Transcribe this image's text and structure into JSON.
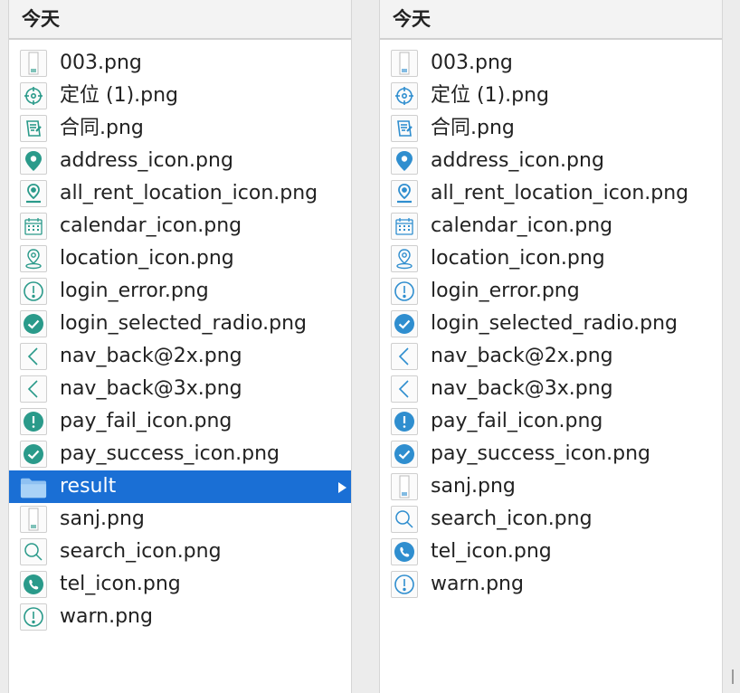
{
  "theme": {
    "left_accent": "#2a9a8a",
    "right_accent": "#2f8ecf",
    "selection": "#1a6fd5"
  },
  "columns": [
    {
      "header": "今天",
      "items": [
        {
          "label": "003.png",
          "icon": "tall-image-icon"
        },
        {
          "label": "定位 (1).png",
          "icon": "crosshair-icon"
        },
        {
          "label": "合同.png",
          "icon": "contract-icon"
        },
        {
          "label": "address_icon.png",
          "icon": "map-pin-filled-icon"
        },
        {
          "label": "all_rent_location_icon.png",
          "icon": "person-pin-icon"
        },
        {
          "label": "calendar_icon.png",
          "icon": "calendar-icon"
        },
        {
          "label": "location_icon.png",
          "icon": "map-pin-outline-icon"
        },
        {
          "label": "login_error.png",
          "icon": "alert-circle-icon"
        },
        {
          "label": "login_selected_radio.png",
          "icon": "check-circle-icon"
        },
        {
          "label": "nav_back@2x.png",
          "icon": "chevron-left-icon"
        },
        {
          "label": "nav_back@3x.png",
          "icon": "chevron-left-icon"
        },
        {
          "label": "pay_fail_icon.png",
          "icon": "alert-filled-icon"
        },
        {
          "label": "pay_success_icon.png",
          "icon": "check-circle-icon"
        },
        {
          "label": "result",
          "icon": "folder-icon",
          "selected": true
        },
        {
          "label": "sanj.png",
          "icon": "tall-image-icon"
        },
        {
          "label": "search_icon.png",
          "icon": "magnifier-icon"
        },
        {
          "label": "tel_icon.png",
          "icon": "phone-icon"
        },
        {
          "label": "warn.png",
          "icon": "alert-circle-icon"
        }
      ]
    },
    {
      "header": "今天",
      "items": [
        {
          "label": "003.png",
          "icon": "tall-image-icon"
        },
        {
          "label": "定位 (1).png",
          "icon": "crosshair-icon"
        },
        {
          "label": "合同.png",
          "icon": "contract-icon"
        },
        {
          "label": "address_icon.png",
          "icon": "map-pin-filled-icon"
        },
        {
          "label": "all_rent_location_icon.png",
          "icon": "person-pin-icon"
        },
        {
          "label": "calendar_icon.png",
          "icon": "calendar-icon"
        },
        {
          "label": "location_icon.png",
          "icon": "map-pin-outline-icon"
        },
        {
          "label": "login_error.png",
          "icon": "alert-circle-icon"
        },
        {
          "label": "login_selected_radio.png",
          "icon": "check-circle-icon"
        },
        {
          "label": "nav_back@2x.png",
          "icon": "chevron-left-icon"
        },
        {
          "label": "nav_back@3x.png",
          "icon": "chevron-left-icon"
        },
        {
          "label": "pay_fail_icon.png",
          "icon": "alert-filled-icon"
        },
        {
          "label": "pay_success_icon.png",
          "icon": "check-circle-icon"
        },
        {
          "label": "sanj.png",
          "icon": "tall-image-icon"
        },
        {
          "label": "search_icon.png",
          "icon": "magnifier-icon"
        },
        {
          "label": "tel_icon.png",
          "icon": "phone-icon"
        },
        {
          "label": "warn.png",
          "icon": "alert-circle-icon"
        }
      ]
    }
  ]
}
